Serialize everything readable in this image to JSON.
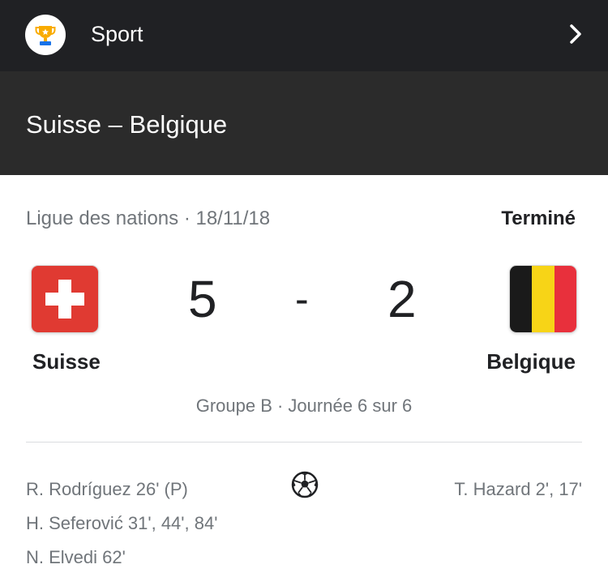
{
  "header": {
    "section_label": "Sport",
    "logo_icon": "trophy-icon",
    "chevron_icon": "chevron-right-icon",
    "background": "#202124"
  },
  "match": {
    "title": "Suisse – Belgique",
    "competition_line": "Ligue des nations · 18/11/18",
    "status": "Terminé",
    "home": {
      "name": "Suisse",
      "score": "5",
      "flag_icon": "switzerland-flag-icon",
      "flag_colors": [
        "#e03a32",
        "#ffffff"
      ],
      "scorers": [
        "R. Rodríguez 26' (P)",
        "H. Seferović 31', 44', 84'",
        "N. Elvedi 62'"
      ]
    },
    "away": {
      "name": "Belgique",
      "score": "2",
      "flag_icon": "belgium-flag-icon",
      "flag_colors": [
        "#1a1a1a",
        "#f7d417",
        "#e8303c"
      ],
      "scorers": [
        "T. Hazard 2', 17'"
      ]
    },
    "score_separator": "-",
    "group_line": "Groupe B · Journée 6 sur 6",
    "goals_icon": "soccer-ball-icon"
  }
}
